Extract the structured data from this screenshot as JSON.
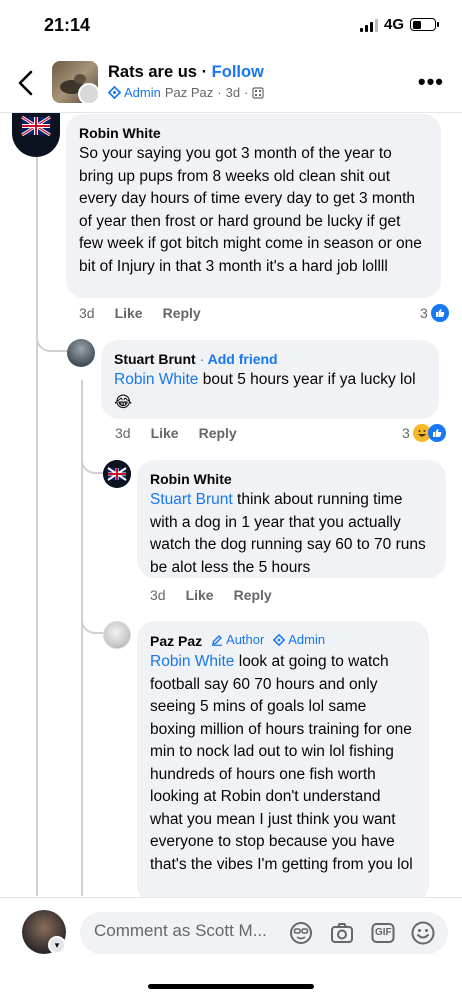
{
  "status": {
    "time": "21:14",
    "network": "4G"
  },
  "header": {
    "group_name": "Rats are us",
    "separator": "·",
    "follow_label": "Follow",
    "admin_label": "Admin",
    "author_name": "Paz Paz",
    "time": "3d",
    "icons": [
      "back-chevron-icon",
      "more-icon",
      "admin-shield-icon",
      "privacy-icon"
    ]
  },
  "comments": [
    {
      "author": "Robin White",
      "text": "So your saying you got 3 month of the year to bring up pups from 8 weeks old clean shit out every day hours of time every day to get 3 month of year then frost or hard ground be lucky if get few week if got bitch might come in season or one bit of Injury in that 3 month it's a hard job lollll",
      "time": "3d",
      "like_label": "Like",
      "reply_label": "Reply",
      "reaction_count": "3",
      "reactions": [
        "like"
      ]
    },
    {
      "author": "Stuart Brunt",
      "separator": "·",
      "add_friend_label": "Add friend",
      "mention": "Robin White",
      "text": " bout 5 hours year if ya lucky lol",
      "emoji": "😂",
      "time": "3d",
      "like_label": "Like",
      "reply_label": "Reply",
      "reaction_count": "3",
      "reactions": [
        "haha",
        "like"
      ]
    },
    {
      "author": "Robin White",
      "mention": "Stuart Brunt",
      "text": " think about running time with a dog in 1 year that you actually watch the dog running say 60 to 70 runs be alot less the 5 hours",
      "time": "3d",
      "like_label": "Like",
      "reply_label": "Reply"
    },
    {
      "author": "Paz Paz",
      "role_author": "Author",
      "role_admin": "Admin",
      "mention": "Robin White",
      "text": " look at going to watch football say 60 70 hours and only seeing 5 mins of goals lol same boxing million of hours training for one min to nock lad out to win lol fishing hundreds of hours one fish worth looking at Robin don't understand what you mean I just think you want everyone to stop because you have that's the vibes I'm getting from you lol"
    }
  ],
  "composer": {
    "placeholder": "Comment as Scott M...",
    "tools": [
      "avatar-sticker-icon",
      "camera-icon",
      "gif-icon",
      "emoji-icon"
    ],
    "gif_label": "GIF"
  },
  "colors": {
    "link": "#1877f2",
    "bubble": "#f0f2f5",
    "meta": "#65676b"
  }
}
